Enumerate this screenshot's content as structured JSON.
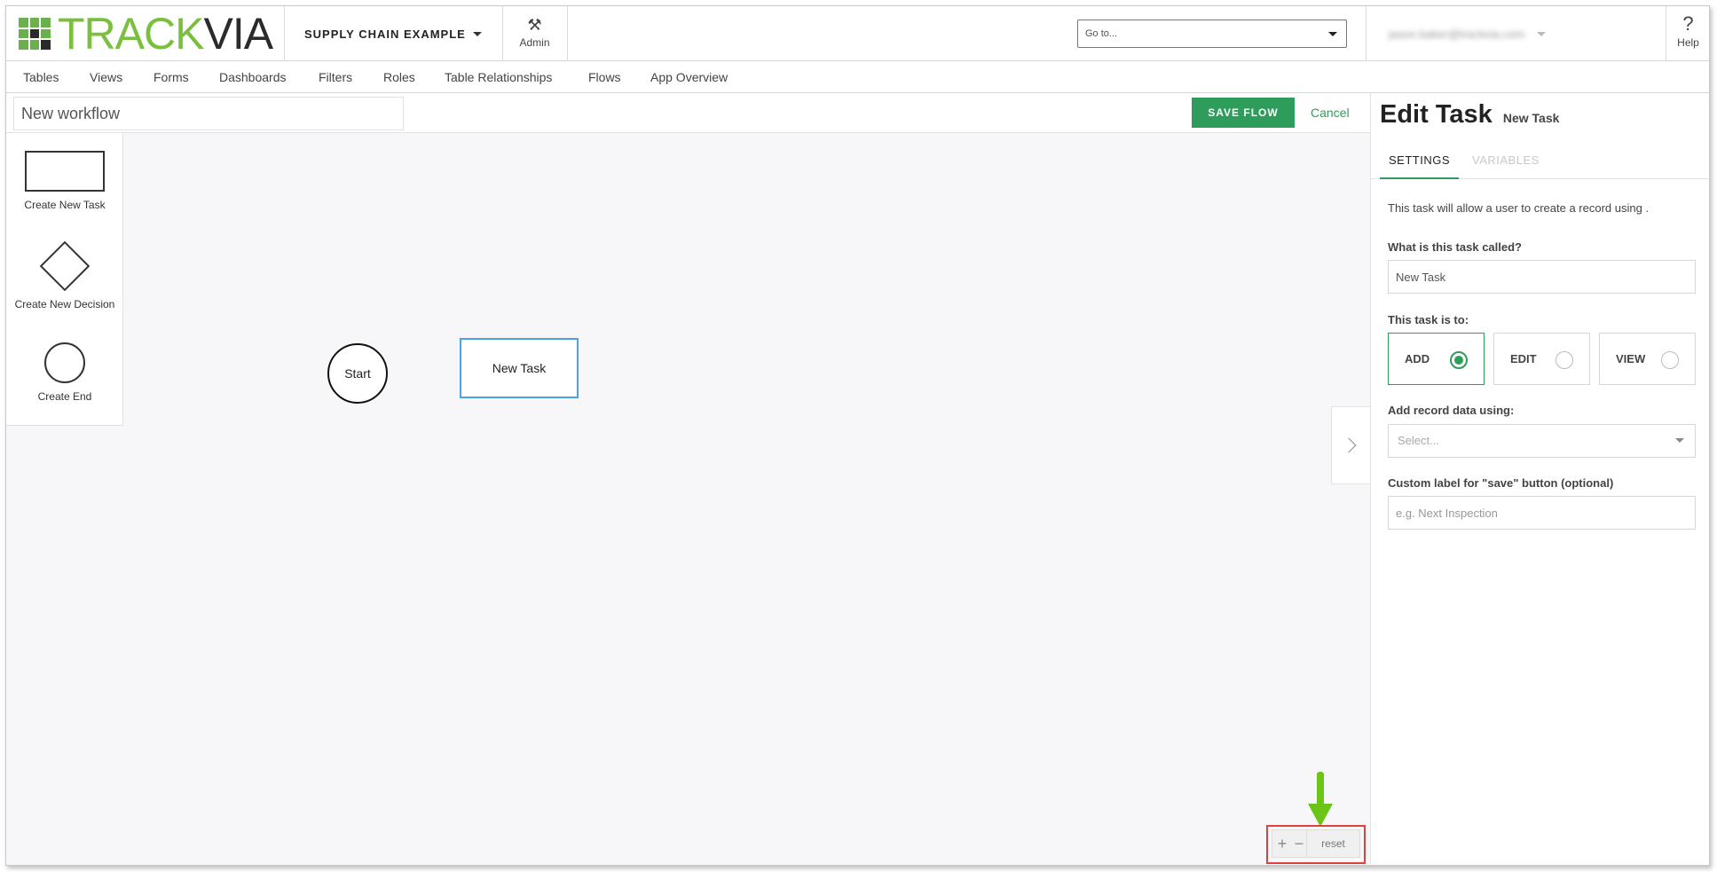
{
  "header": {
    "logo_text_green": "TRACK",
    "logo_text_dark": "VIA",
    "app_name": "SUPPLY CHAIN EXAMPLE",
    "admin_label": "Admin",
    "goto_placeholder": "Go to...",
    "user_email": "jason.baker@trackvia.com",
    "help_label": "Help"
  },
  "nav": {
    "items": [
      "Tables",
      "Views",
      "Forms",
      "Dashboards",
      "Filters",
      "Roles",
      "Table Relationships",
      "Flows",
      "App Overview"
    ]
  },
  "workflow": {
    "name": "New workflow",
    "save_label": "SAVE FLOW",
    "cancel_label": "Cancel"
  },
  "palette": {
    "task_label": "Create New Task",
    "decision_label": "Create New Decision",
    "end_label": "Create End"
  },
  "canvas": {
    "start_label": "Start",
    "task_label": "New Task"
  },
  "zoom": {
    "plus": "+",
    "minus": "−",
    "reset": "reset"
  },
  "panel": {
    "title": "Edit Task",
    "subtitle": "New Task",
    "tabs": [
      "SETTINGS",
      "VARIABLES"
    ],
    "description": "This task will allow a user to create a record using .",
    "name_label": "What is this task called?",
    "name_value": "New Task",
    "mode_label": "This task is to:",
    "modes": [
      "ADD",
      "EDIT",
      "VIEW"
    ],
    "selected_mode": "ADD",
    "record_label": "Add record data using:",
    "record_placeholder": "Select...",
    "save_label_label": "Custom label for \"save\" button (optional)",
    "save_label_placeholder": "e.g. Next Inspection"
  },
  "colors": {
    "brand_green": "#7bbf3e",
    "accent_green": "#2e9c5a",
    "task_border": "#4aa3df",
    "highlight_red": "#e04040",
    "arrow_green": "#6cc417"
  },
  "icons": {
    "admin": "tools-icon",
    "help": "question-icon",
    "collapse": "chevron-right-icon"
  }
}
